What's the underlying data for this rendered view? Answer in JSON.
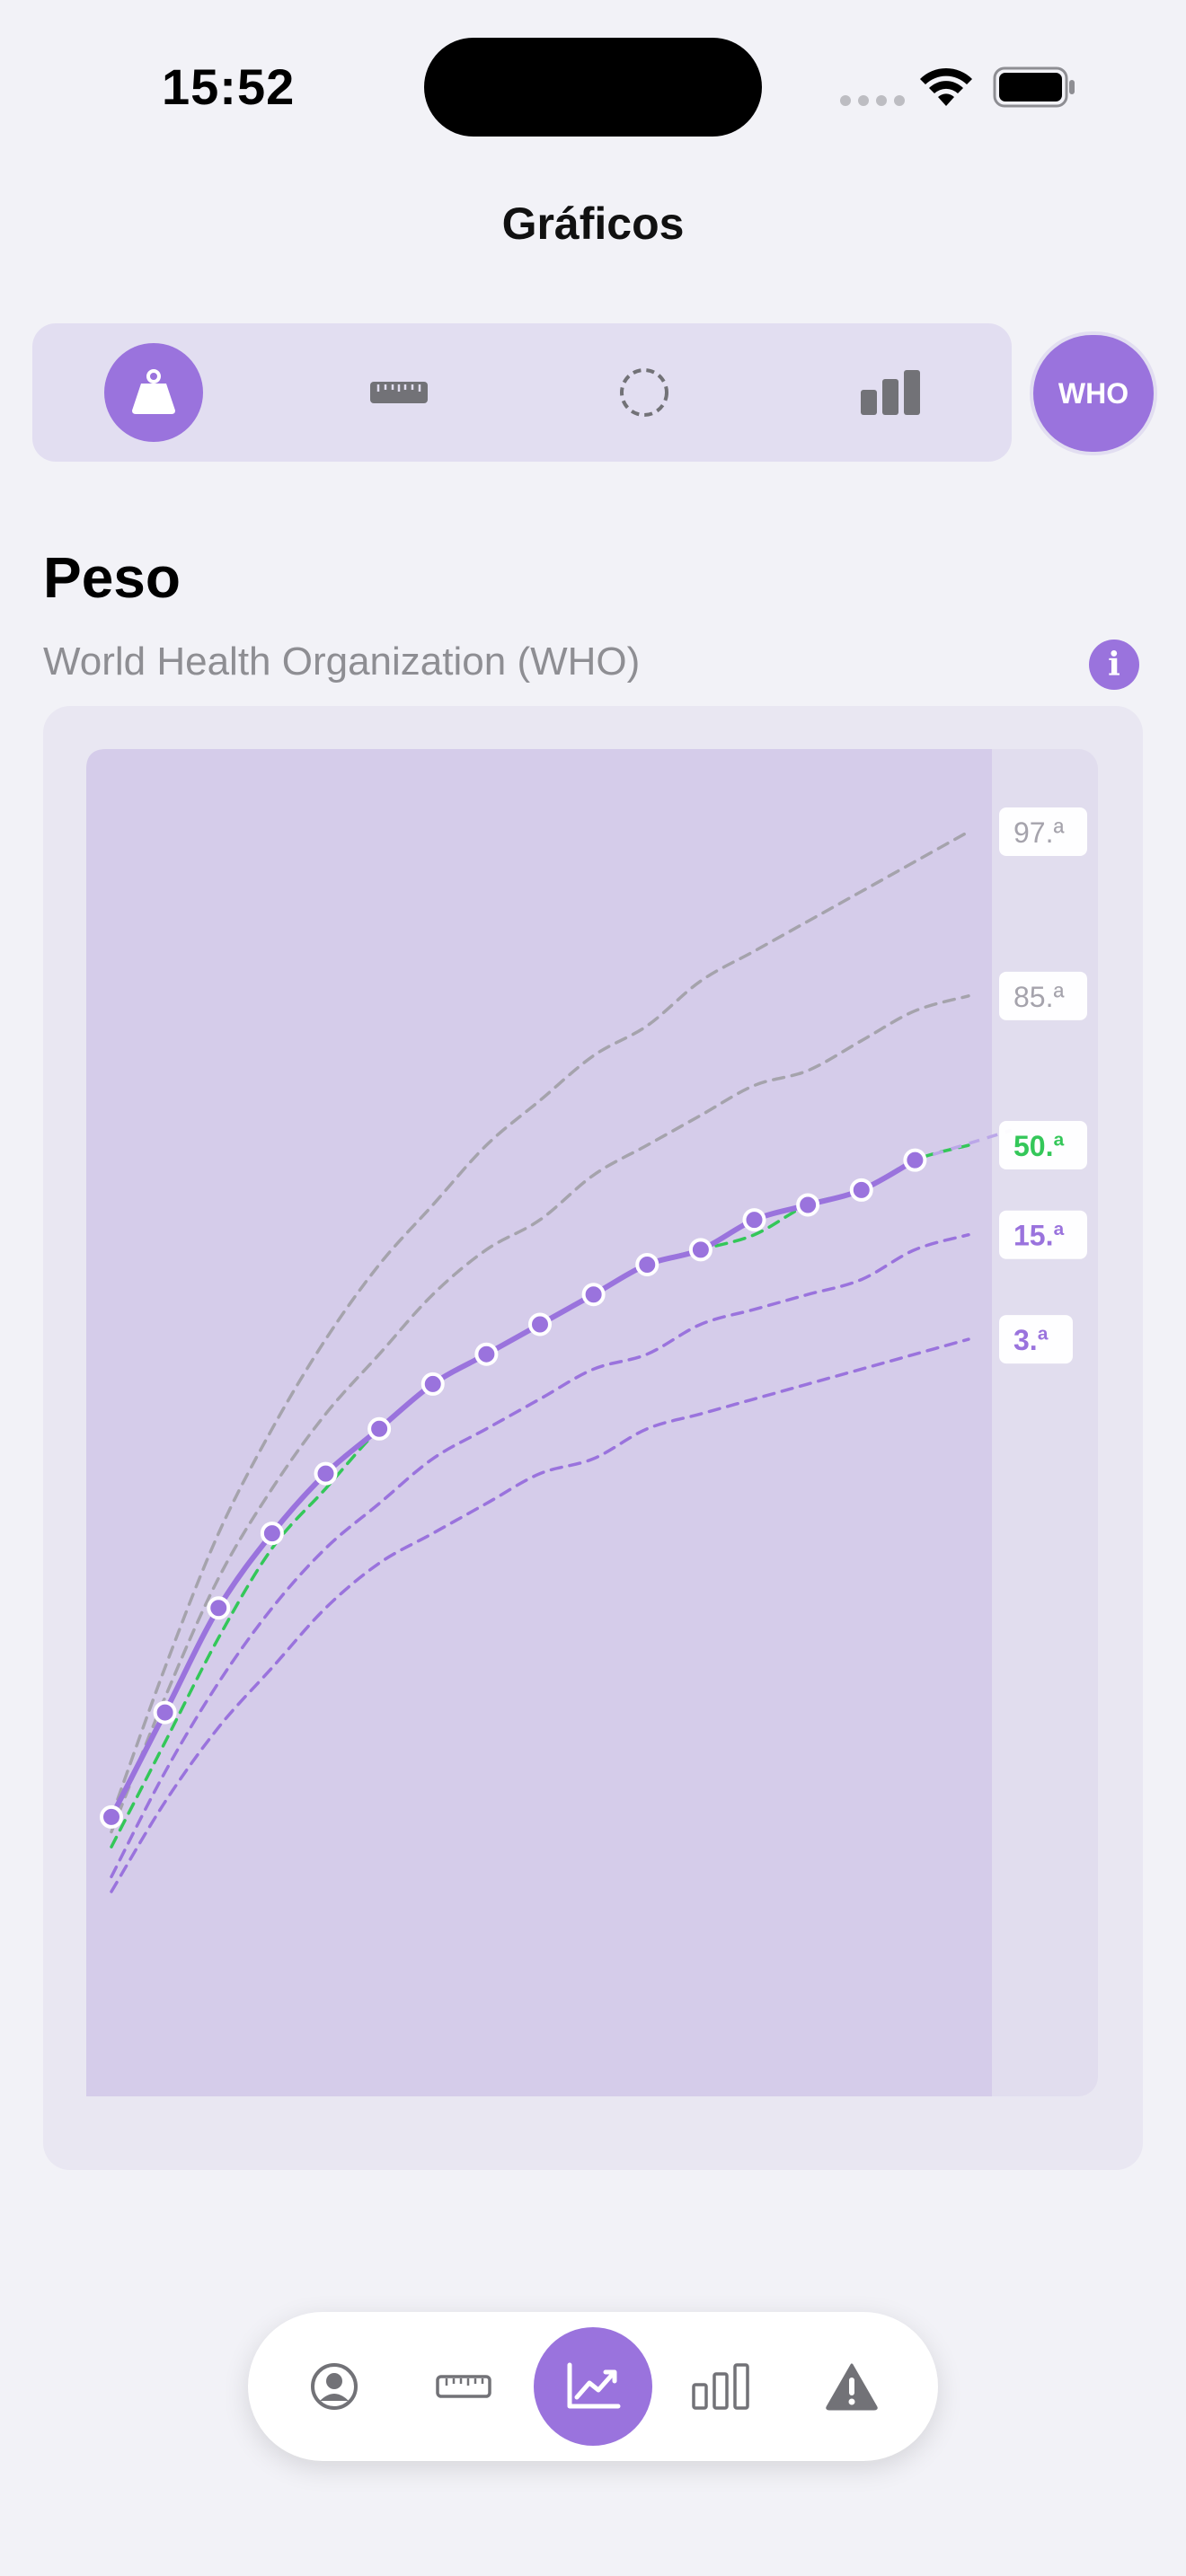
{
  "status": {
    "time": "15:52"
  },
  "nav": {
    "title": "Gráficos"
  },
  "segment": {
    "items": [
      {
        "icon": "weight-icon",
        "active": true
      },
      {
        "icon": "ruler-icon",
        "active": false
      },
      {
        "icon": "head-circumference-icon",
        "active": false
      },
      {
        "icon": "bar-chart-icon",
        "active": false
      }
    ],
    "who_label": "WHO"
  },
  "section": {
    "title": "Peso",
    "subtitle": "World Health Organization (WHO)"
  },
  "colors": {
    "accent": "#9A73DD",
    "green": "#34C759",
    "gray": "#A5A3AC",
    "plot_bg": "#D5CCEA"
  },
  "chart_data": {
    "type": "line",
    "title": "",
    "xlabel": "",
    "ylabel": "",
    "x": [
      0,
      1,
      2,
      3,
      4,
      5,
      6,
      7,
      8,
      9,
      10,
      11,
      12,
      13,
      14,
      15,
      16
    ],
    "xlim": [
      0,
      17
    ],
    "ylim": [
      0,
      10
    ],
    "series": [
      {
        "name": "97.ª",
        "style": "dashed",
        "color": "#A5A3AC",
        "values": [
          1.7,
          2.7,
          3.6,
          4.3,
          4.9,
          5.4,
          5.8,
          6.2,
          6.5,
          6.8,
          7.0,
          7.3,
          7.5,
          7.7,
          7.9,
          8.1,
          8.3
        ]
      },
      {
        "name": "85.ª",
        "style": "dashed",
        "color": "#A5A3AC",
        "values": [
          1.6,
          2.5,
          3.3,
          3.9,
          4.4,
          4.8,
          5.2,
          5.5,
          5.7,
          6.0,
          6.2,
          6.4,
          6.6,
          6.7,
          6.9,
          7.1,
          7.2
        ]
      },
      {
        "name": "50.ª",
        "style": "dashed",
        "color": "#34C759",
        "values": [
          1.5,
          2.2,
          2.9,
          3.5,
          3.9,
          4.3,
          4.6,
          4.8,
          5.0,
          5.2,
          5.4,
          5.5,
          5.6,
          5.8,
          5.9,
          6.1,
          6.2
        ]
      },
      {
        "name": "15.ª",
        "style": "dashed",
        "color": "#9A73DD",
        "values": [
          1.3,
          2.0,
          2.6,
          3.1,
          3.5,
          3.8,
          4.1,
          4.3,
          4.5,
          4.7,
          4.8,
          5.0,
          5.1,
          5.2,
          5.3,
          5.5,
          5.6
        ]
      },
      {
        "name": "3.ª",
        "style": "dashed",
        "color": "#9A73DD",
        "values": [
          1.2,
          1.8,
          2.3,
          2.7,
          3.1,
          3.4,
          3.6,
          3.8,
          4.0,
          4.1,
          4.3,
          4.4,
          4.5,
          4.6,
          4.7,
          4.8,
          4.9
        ]
      },
      {
        "name": "",
        "style": "solid",
        "color": "#9A73DD",
        "markers": true,
        "x": [
          0,
          1,
          2,
          3,
          4,
          5,
          6,
          7,
          8,
          9,
          10,
          11,
          12,
          13,
          14,
          15
        ],
        "values": [
          1.7,
          2.4,
          3.1,
          3.6,
          4.0,
          4.3,
          4.6,
          4.8,
          5.0,
          5.2,
          5.4,
          5.5,
          5.7,
          5.8,
          5.9,
          6.1
        ]
      }
    ],
    "projection": {
      "style": "dashed",
      "color": "#BBA7E8",
      "x": [
        15,
        16.8
      ],
      "values": [
        6.1,
        6.3
      ]
    },
    "legend_placement": "right",
    "grid": false
  },
  "tabbar": {
    "items": [
      {
        "icon": "profile-icon",
        "active": false
      },
      {
        "icon": "ruler-icon",
        "active": false
      },
      {
        "icon": "chart-icon",
        "active": true
      },
      {
        "icon": "bar-chart-icon",
        "active": false
      },
      {
        "icon": "warning-icon",
        "active": false
      }
    ]
  }
}
